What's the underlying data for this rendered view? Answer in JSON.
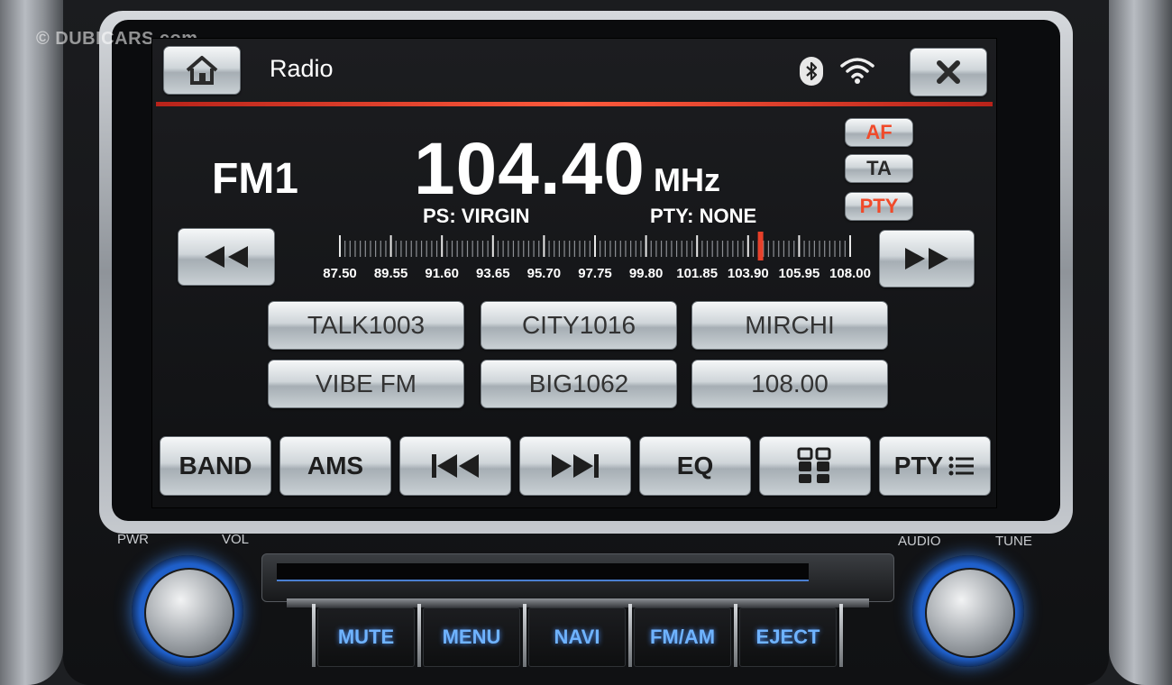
{
  "watermark": "© DUBICARS.com",
  "header": {
    "title": "Radio",
    "home_icon": "home-icon",
    "close_icon": "close-icon",
    "status_icons": [
      "bluetooth-icon",
      "wifi-icon"
    ],
    "accent_color": "#e8402a"
  },
  "tuner": {
    "band": "FM1",
    "frequency": "104.40",
    "unit": "MHz",
    "ps": "PS: VIRGIN",
    "pty": "PTY:  NONE",
    "current_frequency_mhz": 104.4,
    "scale_min_mhz": 87.5,
    "scale_max_mhz": 108.0,
    "scale_labels": [
      "87.50",
      "89.55",
      "91.60",
      "93.65",
      "95.70",
      "97.75",
      "99.80",
      "101.85",
      "103.90",
      "105.95",
      "108.00"
    ]
  },
  "toggles": [
    {
      "label": "AF",
      "active": true
    },
    {
      "label": "TA",
      "active": false
    },
    {
      "label": "PTY",
      "active": true
    }
  ],
  "presets": [
    "TALK1003",
    "CITY1016",
    "MIRCHI",
    "VIBE FM",
    "BIG1062",
    "108.00"
  ],
  "softkeys": {
    "band": "BAND",
    "ams": "AMS",
    "prev_icon": "skip-previous-icon",
    "next_icon": "skip-next-icon",
    "eq": "EQ",
    "grid_icon": "preset-grid-icon",
    "pty": "PTY"
  },
  "hardware": {
    "pwr": "PWR",
    "vol": "VOL",
    "audio": "AUDIO",
    "tune": "TUNE",
    "buttons": [
      "MUTE",
      "MENU",
      "NAVI",
      "FM/AM",
      "EJECT"
    ]
  }
}
